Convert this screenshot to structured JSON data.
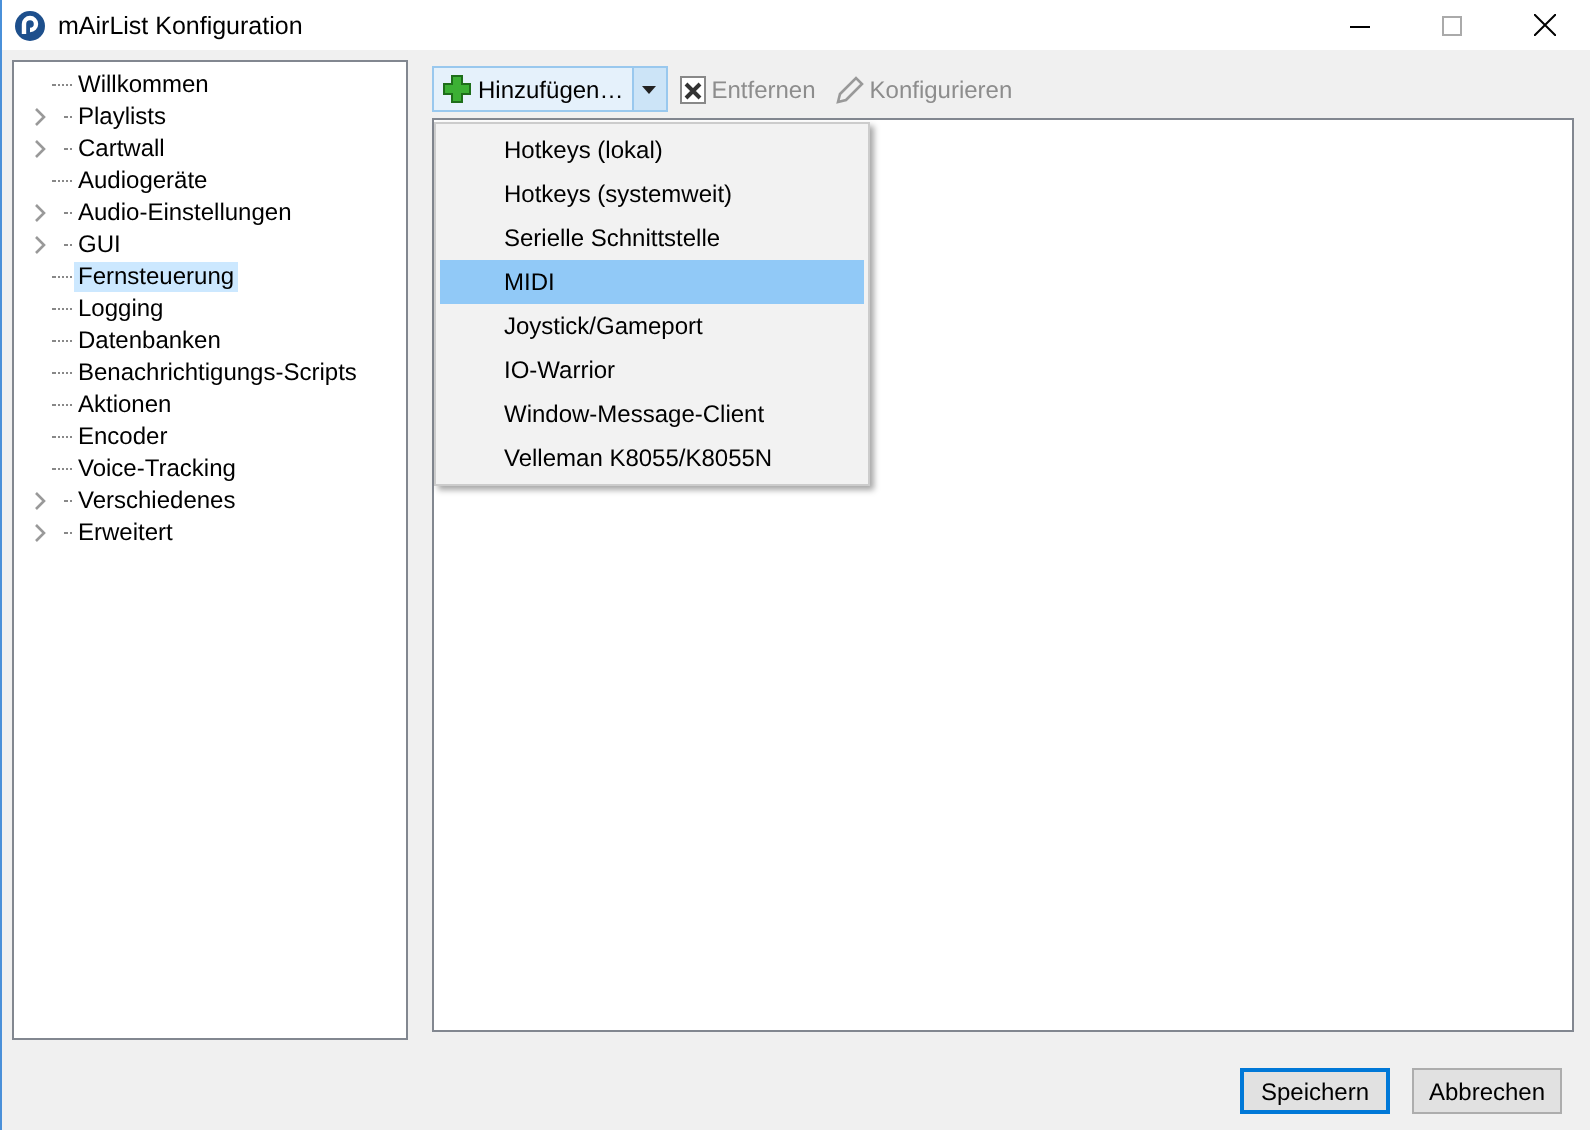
{
  "window": {
    "title": "mAirList Konfiguration"
  },
  "tree": {
    "items": [
      {
        "label": "Willkommen",
        "kind": "leaf",
        "selected": false
      },
      {
        "label": "Playlists",
        "kind": "folder",
        "selected": false
      },
      {
        "label": "Cartwall",
        "kind": "folder",
        "selected": false
      },
      {
        "label": "Audiogeräte",
        "kind": "leaf",
        "selected": false
      },
      {
        "label": "Audio-Einstellungen",
        "kind": "folder",
        "selected": false
      },
      {
        "label": "GUI",
        "kind": "folder",
        "selected": false
      },
      {
        "label": "Fernsteuerung",
        "kind": "leaf",
        "selected": true
      },
      {
        "label": "Logging",
        "kind": "leaf",
        "selected": false
      },
      {
        "label": "Datenbanken",
        "kind": "leaf",
        "selected": false
      },
      {
        "label": "Benachrichtigungs-Scripts",
        "kind": "leaf",
        "selected": false
      },
      {
        "label": "Aktionen",
        "kind": "leaf",
        "selected": false
      },
      {
        "label": "Encoder",
        "kind": "leaf",
        "selected": false
      },
      {
        "label": "Voice-Tracking",
        "kind": "leaf",
        "selected": false
      },
      {
        "label": "Verschiedenes",
        "kind": "folder",
        "selected": false
      },
      {
        "label": "Erweitert",
        "kind": "folder",
        "selected": false
      }
    ]
  },
  "toolbar": {
    "buttons": [
      {
        "label": "Hinzufügen…",
        "kind": "split",
        "disabled": false
      },
      {
        "label": "Entfernen",
        "kind": "plain",
        "disabled": true
      },
      {
        "label": "Konfigurieren",
        "kind": "plain",
        "disabled": true
      }
    ]
  },
  "menu": {
    "items": [
      {
        "label": "Hotkeys (lokal)",
        "selected": false
      },
      {
        "label": "Hotkeys (systemweit)",
        "selected": false
      },
      {
        "label": "Serielle Schnittstelle",
        "selected": false
      },
      {
        "label": "MIDI",
        "selected": true
      },
      {
        "label": "Joystick/Gameport",
        "selected": false
      },
      {
        "label": "IO-Warrior",
        "selected": false
      },
      {
        "label": "Window-Message-Client",
        "selected": false
      },
      {
        "label": "Velleman K8055/K8055N",
        "selected": false
      }
    ]
  },
  "dialog_buttons": [
    {
      "label": "Speichern",
      "focused": true
    },
    {
      "label": "Abbrechen",
      "focused": false
    }
  ]
}
